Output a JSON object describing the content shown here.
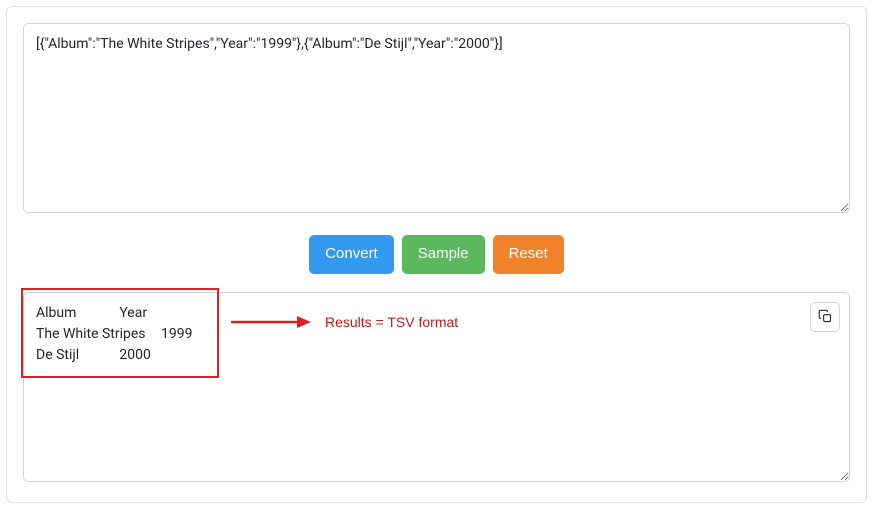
{
  "input": {
    "value": "[{\"Album\":\"The White Stripes\",\"Year\":\"1999\"},{\"Album\":\"De Stijl\",\"Year\":\"2000\"}]"
  },
  "buttons": {
    "convert": "Convert",
    "sample": "Sample",
    "reset": "Reset"
  },
  "output": {
    "value": "Album\tYear\nThe White Stripes\t1999\nDe Stijl\t2000"
  },
  "annotation": {
    "label": "Results = TSV format"
  }
}
